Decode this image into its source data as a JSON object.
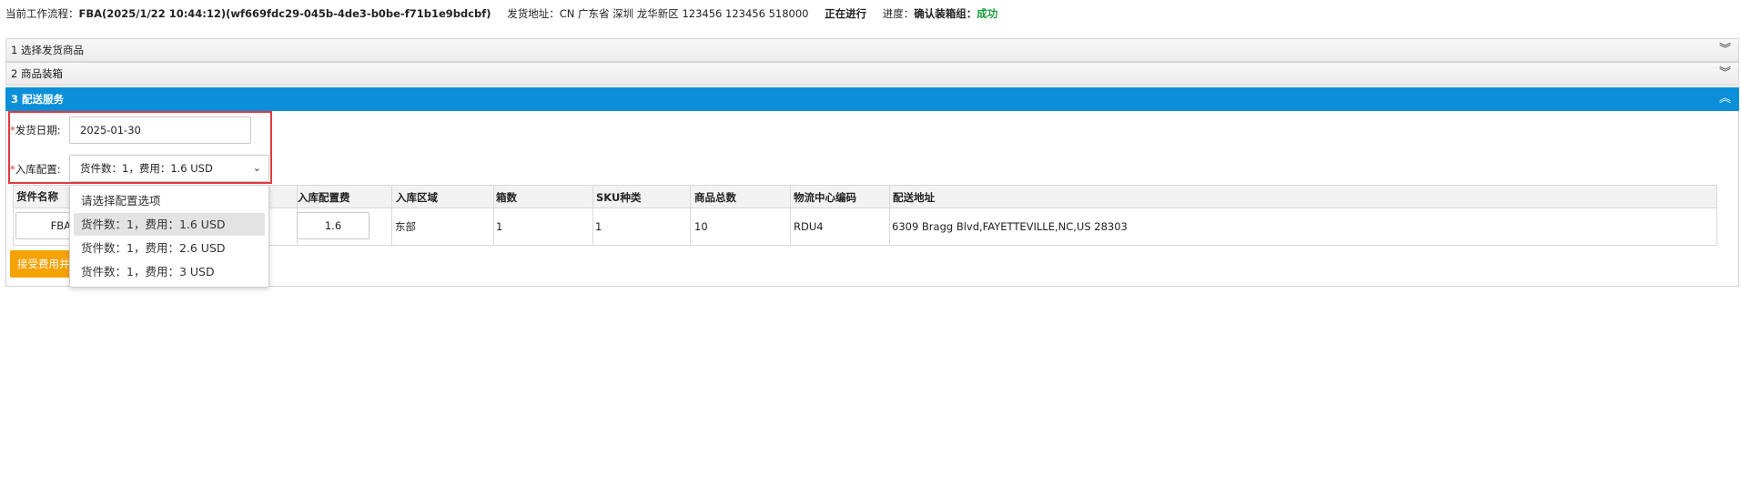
{
  "header": {
    "workflow_label": "当前工作流程：",
    "workflow_value": "FBA(2025/1/22 10:44:12)(wf669fdc29-045b-4de3-b0be-f71b1e9bdcbf)",
    "ship_from_label": "发货地址：",
    "ship_from_value": "CN 广东省 深圳 龙华新区 123456 123456 518000",
    "status": "正在进行",
    "progress_label": "进度：",
    "progress_step": "确认装箱组：",
    "progress_result": "成功"
  },
  "accordion": {
    "step1": "1 选择发货商品",
    "step2": "2 商品装箱",
    "step3": "3 配送服务",
    "collapsed_icon": "chevron-double-down-icon",
    "expanded_icon": "chevron-double-up-icon"
  },
  "form": {
    "required_mark": "*",
    "ship_date_label": "发货日期:",
    "ship_date_value": "2025-01-30",
    "inbound_label": "入库配置:",
    "inbound_selected": "货件数：1，费用：1.6 USD"
  },
  "dropdown": {
    "options": [
      "请选择配置选项",
      "货件数：1，费用：1.6 USD",
      "货件数：1，费用：2.6 USD",
      "货件数：1，费用：3 USD"
    ],
    "selected_index": 1
  },
  "table": {
    "headers": [
      "货件名称",
      "入库配置费",
      "入库区域",
      "箱数",
      "SKU种类",
      "商品总数",
      "物流中心编码",
      "配送地址"
    ],
    "row": {
      "shipment_name": "FBA",
      "inbound_fee": "1.6",
      "region": "东部",
      "boxes": "1",
      "sku_types": "1",
      "total_items": "10",
      "fc_code": "RDU4",
      "address": "6309 Bragg Blvd,FAYETTEVILLE,NC,US 28303"
    }
  },
  "buttons": {
    "accept_fee": "接受费用并"
  },
  "colors": {
    "active_step": "#0b8fd9",
    "highlight": "#e4393c",
    "success": "#1a9c3a",
    "accept_button": "#f6a200"
  }
}
